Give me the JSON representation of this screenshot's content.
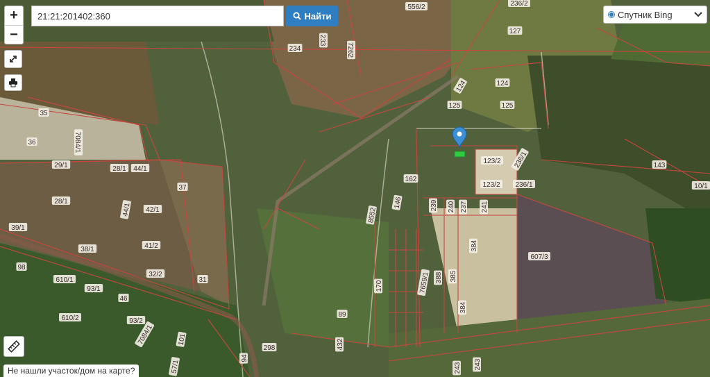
{
  "zoom": {
    "in_label": "+",
    "out_label": "−"
  },
  "search": {
    "value": "21:21:201402:360",
    "button_label": "Найти"
  },
  "layer": {
    "selected": "Спутник Bing"
  },
  "bottom_message": "Не нашли участок/дом на карте?",
  "colors": {
    "boundary": "#c8463f",
    "button": "#2f7ec1",
    "marker": "#3a8fd6",
    "selected_parcel": "#2ecc40"
  },
  "icons": [
    "search-icon",
    "fullscreen-icon",
    "print-icon",
    "ruler-icon",
    "map-marker-icon",
    "chevron-down-icon"
  ],
  "parcel_labels": [
    "556/2",
    "236/2",
    "127",
    "234",
    "233",
    "7262",
    "124",
    "124",
    "125",
    "125",
    "35",
    "36",
    "7084/1",
    "29/1",
    "28/1",
    "44/1",
    "123/2",
    "236/1",
    "143",
    "10/1",
    "162",
    "123/2",
    "236/1",
    "37",
    "28/1",
    "42/1",
    "44/1",
    "8552",
    "146",
    "239",
    "240",
    "237",
    "241",
    "39/1",
    "41/2",
    "38/1",
    "384",
    "607/3",
    "98",
    "32/2",
    "31",
    "610/1",
    "93/1",
    "46",
    "170",
    "7659/1",
    "385",
    "388",
    "89",
    "384",
    "610/2",
    "93/2",
    "7084/1",
    "101",
    "432",
    "298",
    "94",
    "243",
    "243",
    "57/1"
  ]
}
